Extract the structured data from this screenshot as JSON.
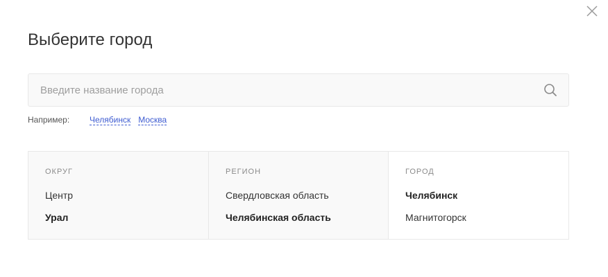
{
  "modal": {
    "title": "Выберите город"
  },
  "search": {
    "placeholder": "Введите название города",
    "value": ""
  },
  "examples": {
    "label": "Например:",
    "links": [
      "Челябинск",
      "Москва"
    ]
  },
  "selector": {
    "district": {
      "header": "Округ",
      "items": [
        {
          "label": "Центр",
          "selected": false
        },
        {
          "label": "Урал",
          "selected": true
        }
      ]
    },
    "region": {
      "header": "Регион",
      "items": [
        {
          "label": "Свердловская область",
          "selected": false
        },
        {
          "label": "Челябинская область",
          "selected": true
        }
      ]
    },
    "city": {
      "header": "Город",
      "items": [
        {
          "label": "Челябинск",
          "selected": true
        },
        {
          "label": "Магнитогорск",
          "selected": false
        }
      ]
    }
  },
  "colors": {
    "link": "#3d5bd1",
    "panel_bg": "#f9f9f9",
    "border": "#e8e8e8"
  },
  "icons": {
    "close": "close-icon",
    "search": "search-icon"
  }
}
